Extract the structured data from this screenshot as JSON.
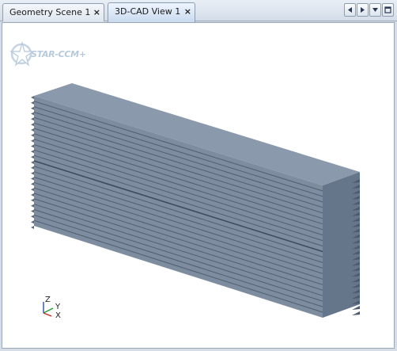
{
  "tabs": [
    {
      "label": "Geometry Scene 1",
      "close": "×",
      "active": false
    },
    {
      "label": "3D-CAD View 1",
      "close": "×",
      "active": true
    }
  ],
  "nav_buttons": [
    "left-arrow-icon",
    "right-arrow-icon",
    "dropdown-icon",
    "maximize-icon"
  ],
  "viewport": {
    "logo_text": "STAR-CCM+",
    "axes": {
      "z": "Z",
      "y": "Y",
      "x": "X"
    },
    "model_color": "#7b8a9c"
  },
  "colors": {
    "tab_active": "#c9daef",
    "model_top": "#8796a8",
    "model_side": "#66768a"
  }
}
